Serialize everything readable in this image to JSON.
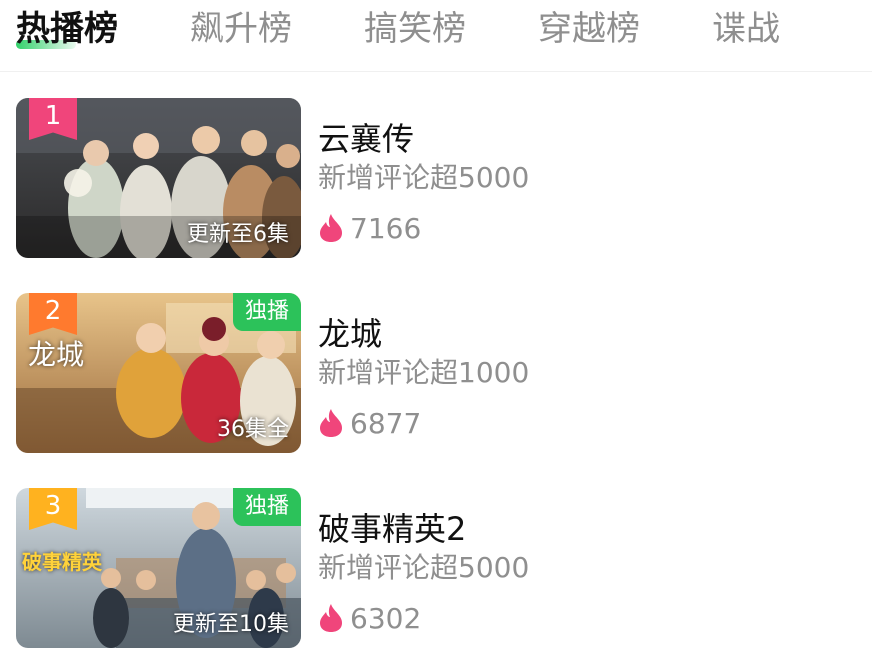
{
  "tabs": [
    {
      "label": "热播榜",
      "active": true
    },
    {
      "label": "飙升榜",
      "active": false
    },
    {
      "label": "搞笑榜",
      "active": false
    },
    {
      "label": "穿越榜",
      "active": false
    },
    {
      "label": "谍战",
      "active": false
    }
  ],
  "items": [
    {
      "rank": "1",
      "rank_color": "#f0457b",
      "title": "云襄传",
      "subtitle": "新增评论超5000",
      "heat": "7166",
      "episode": "更新至6集",
      "badge": "",
      "poster_text": ""
    },
    {
      "rank": "2",
      "rank_color": "#ff7a2e",
      "title": "龙城",
      "subtitle": "新增评论超1000",
      "heat": "6877",
      "episode": "36集全",
      "badge": "独播",
      "poster_text": "龙城"
    },
    {
      "rank": "3",
      "rank_color": "#ffb21f",
      "title": "破事精英2",
      "subtitle": "新增评论超5000",
      "heat": "6302",
      "episode": "更新至10集",
      "badge": "独播",
      "poster_text": "破事精英"
    }
  ],
  "colors": {
    "accent_green": "#2cc25a",
    "heat_icon": "#f0457b",
    "muted_text": "#8f8f8f"
  },
  "icons": {
    "heat": "flame-icon"
  }
}
